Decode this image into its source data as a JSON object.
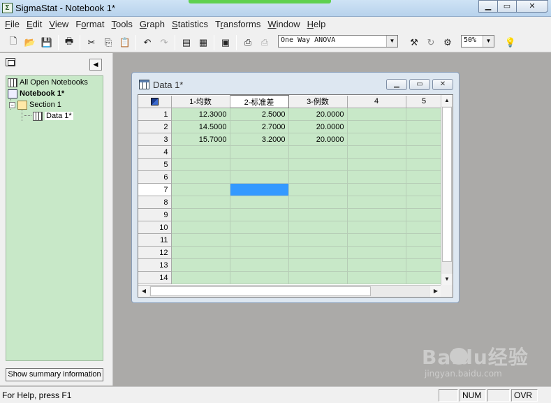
{
  "window": {
    "title": "SigmaStat - Notebook 1*"
  },
  "menubar": [
    {
      "label": "File",
      "u": "F"
    },
    {
      "label": "Edit",
      "u": "E"
    },
    {
      "label": "View",
      "u": "V"
    },
    {
      "label": "Format",
      "u": "o"
    },
    {
      "label": "Tools",
      "u": "T"
    },
    {
      "label": "Graph",
      "u": "G"
    },
    {
      "label": "Statistics",
      "u": "S"
    },
    {
      "label": "Transforms",
      "u": "r"
    },
    {
      "label": "Window",
      "u": "W"
    },
    {
      "label": "Help",
      "u": "H"
    }
  ],
  "toolbar": {
    "test_select": {
      "value": "One Way ANOVA"
    },
    "zoom_select": {
      "value": "50%"
    }
  },
  "tree": {
    "items": [
      {
        "label": "All Open Notebooks",
        "bold": false
      },
      {
        "label": "Notebook 1*",
        "bold": true
      },
      {
        "label": "Section 1",
        "bold": false
      },
      {
        "label": "Data 1*",
        "bold": false,
        "selected": true
      }
    ],
    "summary_button": "Show summary information"
  },
  "data_window": {
    "title": "Data 1*",
    "columns": [
      "1-均数",
      "2-标准差",
      "3-例数",
      "4",
      "5"
    ],
    "rows": [
      {
        "n": "1",
        "cells": [
          "12.3000",
          "2.5000",
          "20.0000",
          "",
          ""
        ]
      },
      {
        "n": "2",
        "cells": [
          "14.5000",
          "2.7000",
          "20.0000",
          "",
          ""
        ]
      },
      {
        "n": "3",
        "cells": [
          "15.7000",
          "3.2000",
          "20.0000",
          "",
          ""
        ]
      },
      {
        "n": "4",
        "cells": [
          "",
          "",
          "",
          "",
          ""
        ]
      },
      {
        "n": "5",
        "cells": [
          "",
          "",
          "",
          "",
          ""
        ]
      },
      {
        "n": "6",
        "cells": [
          "",
          "",
          "",
          "",
          ""
        ]
      },
      {
        "n": "7",
        "cells": [
          "",
          "",
          "",
          "",
          ""
        ]
      },
      {
        "n": "8",
        "cells": [
          "",
          "",
          "",
          "",
          ""
        ]
      },
      {
        "n": "9",
        "cells": [
          "",
          "",
          "",
          "",
          ""
        ]
      },
      {
        "n": "10",
        "cells": [
          "",
          "",
          "",
          "",
          ""
        ]
      },
      {
        "n": "11",
        "cells": [
          "",
          "",
          "",
          "",
          ""
        ]
      },
      {
        "n": "12",
        "cells": [
          "",
          "",
          "",
          "",
          ""
        ]
      },
      {
        "n": "13",
        "cells": [
          "",
          "",
          "",
          "",
          ""
        ]
      },
      {
        "n": "14",
        "cells": [
          "",
          "",
          "",
          "",
          ""
        ]
      }
    ],
    "active_cell": {
      "row": 7,
      "col": 2
    }
  },
  "statusbar": {
    "message": "For Help, press F1",
    "num": "NUM",
    "ovr": "OVR"
  },
  "watermark": {
    "brand": "Baidu经验",
    "sub": "jingyan.baidu.com"
  },
  "colors": {
    "cell_bg": "#c8e8c8",
    "active_cell": "#3399ff",
    "workspace": "#abaaa8"
  }
}
